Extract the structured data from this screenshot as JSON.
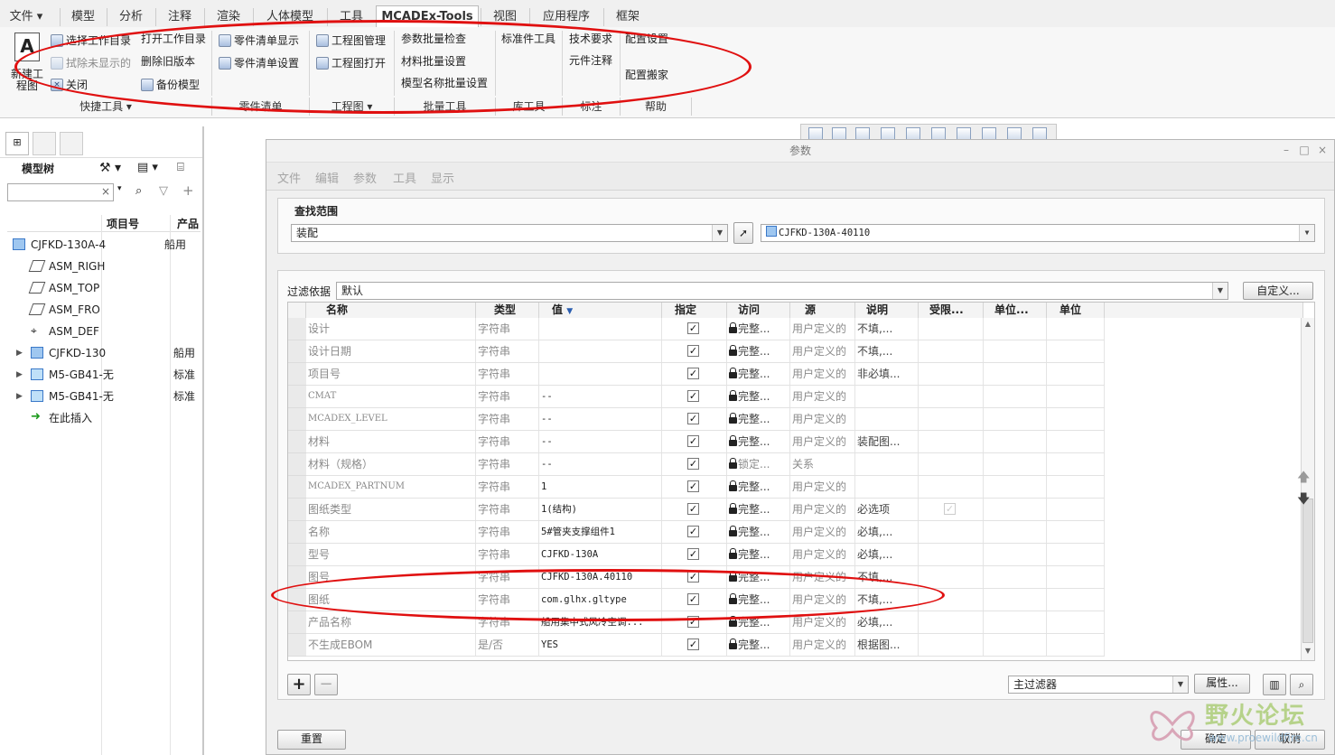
{
  "ribbon": {
    "tabs": [
      "文件",
      "模型",
      "分析",
      "注释",
      "渲染",
      "人体模型",
      "工具",
      "MCADEx-Tools",
      "视图",
      "应用程序",
      "框架"
    ],
    "active_tab": "MCADEx-Tools",
    "items": {
      "new_drawing": "新建工程图",
      "select_work_dir": "选择工作目录",
      "open_work_dir": "打开工作目录",
      "erase_not_displayed": "拭除未显示的",
      "delete_old_versions": "删除旧版本",
      "close": "关闭",
      "backup_model": "备份模型",
      "parts_list_display": "零件清单显示",
      "parts_list_settings": "零件清单设置",
      "drawing_manage": "工程图管理",
      "drawing_open": "工程图打开",
      "param_batch_check": "参数批量检查",
      "material_batch_set": "材料批量设置",
      "model_name_batch_set": "模型名称批量设置",
      "standard_parts_tool": "标准件工具",
      "tech_requirements": "技术要求",
      "component_note": "元件注释",
      "config_settings": "配置设置",
      "config_move": "配置搬家"
    },
    "groups": [
      "快捷工具",
      "零件清单",
      "工程图",
      "批量工具",
      "库工具",
      "标注",
      "帮助"
    ]
  },
  "left_panel": {
    "model_tree_label": "模型树",
    "columns": [
      "项目号",
      "产品"
    ],
    "rows": [
      {
        "name": "CJFKD-130A-4",
        "product": "船用"
      },
      {
        "name": "ASM_RIGH",
        "product": ""
      },
      {
        "name": "ASM_TOP",
        "product": ""
      },
      {
        "name": "ASM_FRO",
        "product": ""
      },
      {
        "name": "ASM_DEF",
        "product": ""
      },
      {
        "name": "CJFKD-130",
        "product": "船用"
      },
      {
        "name": "M5-GB41-无",
        "product": "标准"
      },
      {
        "name": "M5-GB41-无",
        "product": "标准"
      },
      {
        "name": "在此插入",
        "product": ""
      }
    ]
  },
  "dialog": {
    "title": "参数",
    "menu": [
      "文件",
      "编辑",
      "参数",
      "工具",
      "显示"
    ],
    "search_scope_label": "查找范围",
    "scope_value": "装配",
    "scope_object": "CJFKD-130A-40110",
    "filter_label": "过滤依据",
    "filter_value": "默认",
    "customize_button": "自定义...",
    "columns": [
      "名称",
      "类型",
      "值",
      "指定",
      "访问",
      "源",
      "说明",
      "受限...",
      "单位...",
      "单位"
    ],
    "rows": [
      {
        "name": "设计",
        "type": "字符串",
        "value": "",
        "access": "完整...",
        "source": "用户定义的",
        "desc": "不填,..."
      },
      {
        "name": "设计日期",
        "type": "字符串",
        "value": "",
        "access": "完整...",
        "source": "用户定义的",
        "desc": "不填,..."
      },
      {
        "name": "项目号",
        "type": "字符串",
        "value": "",
        "access": "完整...",
        "source": "用户定义的",
        "desc": "非必填..."
      },
      {
        "name": "CMAT",
        "type": "字符串",
        "value": "--",
        "access": "完整...",
        "source": "用户定义的",
        "desc": ""
      },
      {
        "name": "MCADEX_LEVEL",
        "type": "字符串",
        "value": "--",
        "access": "完整...",
        "source": "用户定义的",
        "desc": ""
      },
      {
        "name": "材料",
        "type": "字符串",
        "value": "--",
        "access": "完整...",
        "source": "用户定义的",
        "desc": "装配图..."
      },
      {
        "name": "材料（规格）",
        "type": "字符串",
        "value": "--",
        "access": "锁定...",
        "source": "关系",
        "desc": ""
      },
      {
        "name": "MCADEX_PARTNUM",
        "type": "字符串",
        "value": "1",
        "access": "完整...",
        "source": "用户定义的",
        "desc": ""
      },
      {
        "name": "图纸类型",
        "type": "字符串",
        "value": "1(结构)",
        "access": "完整...",
        "source": "用户定义的",
        "desc": "必选项"
      },
      {
        "name": "名称",
        "type": "字符串",
        "value": "5#管夹支撑组件1",
        "access": "完整...",
        "source": "用户定义的",
        "desc": "必填,..."
      },
      {
        "name": "型号",
        "type": "字符串",
        "value": "CJFKD-130A",
        "access": "完整...",
        "source": "用户定义的",
        "desc": "必填,..."
      },
      {
        "name": "图号",
        "type": "字符串",
        "value": "CJFKD-130A.40110",
        "access": "完整...",
        "source": "用户定义的",
        "desc": "不填,..."
      },
      {
        "name": "图纸",
        "type": "字符串",
        "value": "com.glhx.gltype",
        "access": "完整...",
        "source": "用户定义的",
        "desc": "不填,..."
      },
      {
        "name": "产品名称",
        "type": "字符串",
        "value": "船用集中式风冷空调...",
        "access": "完整...",
        "source": "用户定义的",
        "desc": "必填,..."
      },
      {
        "name": "不生成EBOM",
        "type": "是/否",
        "value": "YES",
        "access": "完整...",
        "source": "用户定义的",
        "desc": "根据图..."
      }
    ],
    "main_filter": "主过滤器",
    "properties_button": "属性...",
    "reset_button": "重置",
    "ok_button": "确定",
    "cancel_button": "取消"
  },
  "watermark": {
    "text": "野火论坛",
    "url": "www.proewildfire.cn"
  },
  "colors": {
    "annotation": "#e01010",
    "tab_active_bg": "#ffffff",
    "dialog_bg": "#f0f0f0"
  }
}
